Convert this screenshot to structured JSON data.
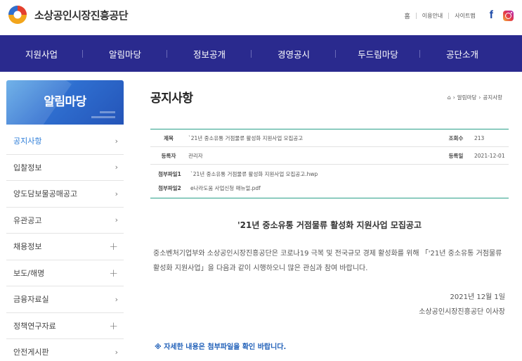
{
  "header": {
    "logo_text": "소상공인시장진흥공단",
    "utility": {
      "home": "홈",
      "guide": "이용안내",
      "sitemap": "사이트맵"
    },
    "social": {
      "facebook": "f"
    }
  },
  "gnb": {
    "items": [
      "지원사업",
      "알림마당",
      "정보공개",
      "경영공시",
      "두드림마당",
      "공단소개"
    ]
  },
  "sidebar": {
    "title": "알림마당",
    "items": [
      {
        "label": "공지사항",
        "marker": "›"
      },
      {
        "label": "입찰정보",
        "marker": "›"
      },
      {
        "label": "양도담보물공매공고",
        "marker": "›"
      },
      {
        "label": "유관공고",
        "marker": "›"
      },
      {
        "label": "채용정보",
        "marker": "+"
      },
      {
        "label": "보도/해명",
        "marker": "+"
      },
      {
        "label": "금융자료실",
        "marker": "›"
      },
      {
        "label": "정책연구자료",
        "marker": "+"
      },
      {
        "label": "안전게시판",
        "marker": "›"
      }
    ]
  },
  "page": {
    "title": "공지사항",
    "breadcrumb": [
      "알림마당",
      "공지사항"
    ]
  },
  "post": {
    "labels": {
      "subject": "제목",
      "views": "조회수",
      "author": "등록자",
      "date": "등록일",
      "attach1": "첨부파일1",
      "attach2": "첨부파일2"
    },
    "subject": "`21년 중소유통 거점물류 활성화 지원사업 모집공고",
    "views": "213",
    "author": "관리자",
    "reg_date": "2021-12-01",
    "attach1": "`21년 중소유통 거점물류 활성화 지원사업 모집공고.hwp",
    "attach2": "e나라도움 사업신청 매뉴얼.pdf"
  },
  "notice": {
    "title": "'21년 중소유통 거점물류 활성화 지원사업 모집공고",
    "body": "중소벤처기업부와 소상공인시장진흥공단은 코로나19 극복 및 전국규모 경제 활성화를 위해 「'21년 중소유통 거점물류 활성화 지원사업」을 다음과 같이 시행하오니 많은 관심과 참여 바랍니다.",
    "date": "2021년 12월 1일",
    "signer": "소상공인시장진흥공단 이사장",
    "note": "※ 자세한 내용은 첨부파일을 확인 바랍니다."
  },
  "colors": {
    "gnb_bg": "#2a2a8e",
    "active_menu": "#2b7cd8",
    "table_accent": "#2aa08a",
    "note": "#1f5fb8"
  }
}
